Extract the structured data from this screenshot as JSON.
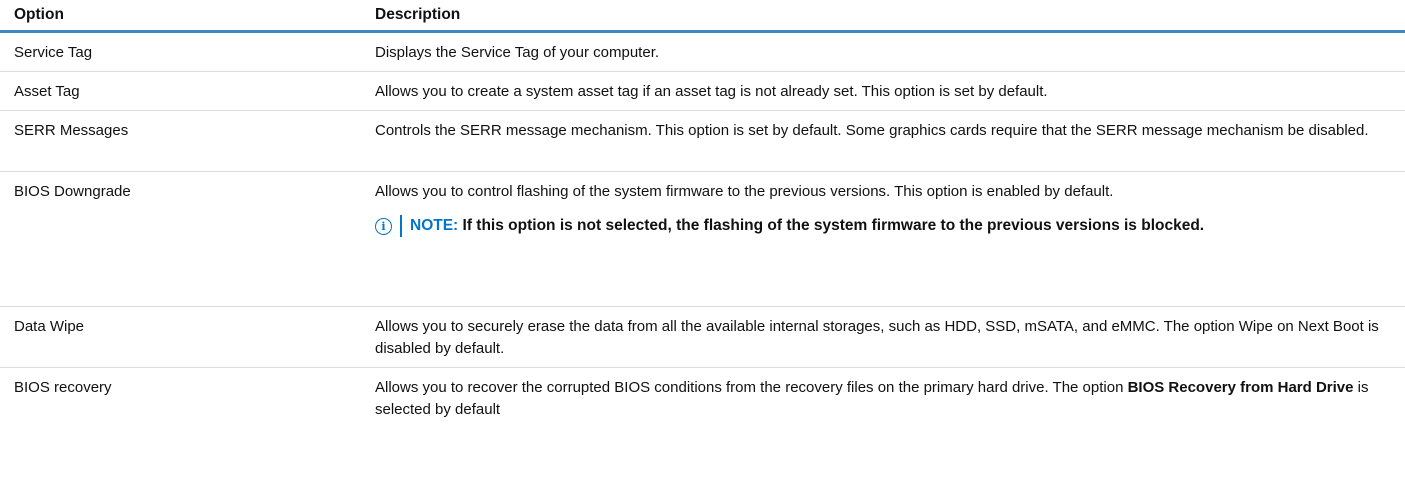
{
  "table": {
    "headers": {
      "option": "Option",
      "description": "Description"
    },
    "rows": [
      {
        "option": "Service Tag",
        "description": "Displays the Service Tag of your computer."
      },
      {
        "option": "Asset Tag",
        "description": "Allows you to create a system asset tag if an asset tag is not already set. This option is set by default."
      },
      {
        "option": "SERR Messages",
        "description": "Controls the SERR message mechanism. This option is set by default. Some graphics cards require that the SERR message mechanism be disabled."
      },
      {
        "option": "BIOS Downgrade",
        "description": "Allows you to control flashing of the system firmware to the previous versions. This option is enabled by default.",
        "note": {
          "label": "NOTE:",
          "text": "If this option is not selected, the flashing of the system firmware to the previous versions is blocked."
        }
      },
      {
        "option": "Data Wipe",
        "description": "Allows you to securely erase the data from all the available internal storages, such as HDD, SSD, mSATA, and eMMC. The option Wipe on Next Boot is disabled by default."
      },
      {
        "option": "BIOS recovery",
        "description_before": "Allows you to recover the corrupted BIOS conditions from the recovery files on the primary hard drive. The option ",
        "description_bold": "BIOS Recovery from Hard Drive",
        "description_after": " is selected by default"
      }
    ]
  },
  "icons": {
    "note_icon": "info-circle-icon",
    "accent_color": "#0076ce",
    "header_rule_color": "#3b88c4"
  }
}
